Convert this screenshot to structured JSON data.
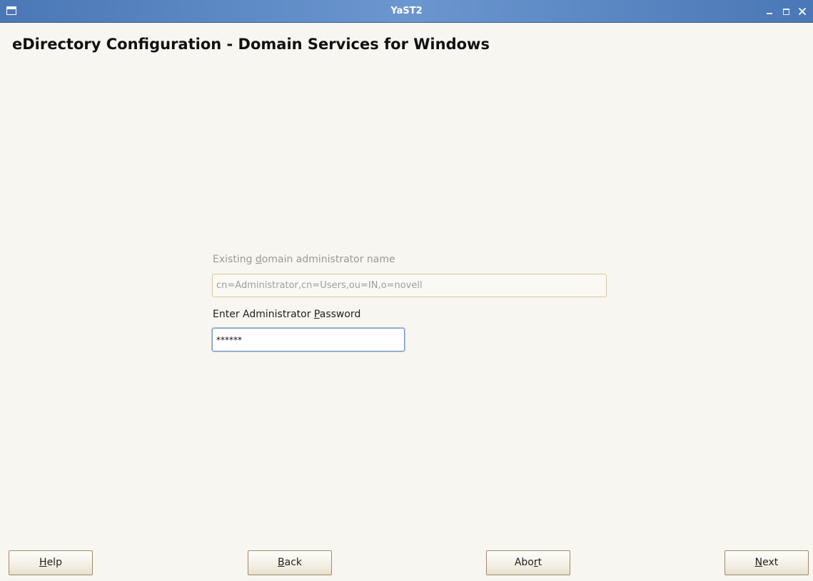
{
  "window": {
    "title": "YaST2"
  },
  "page": {
    "title": "eDirectory Configuration - Domain Services for Windows"
  },
  "form": {
    "admin_name": {
      "label_before": "Existing ",
      "label_mnemonic": "d",
      "label_after": "omain administrator name",
      "value": "cn=Administrator,cn=Users,ou=IN,o=novell",
      "disabled": true
    },
    "password": {
      "label_before": "Enter Administrator ",
      "label_mnemonic": "P",
      "label_after": "assword",
      "value": "******"
    }
  },
  "buttons": {
    "help": {
      "before": "",
      "mnemonic": "H",
      "after": "elp"
    },
    "back": {
      "before": "",
      "mnemonic": "B",
      "after": "ack"
    },
    "abort": {
      "before": "Abo",
      "mnemonic": "r",
      "after": "t"
    },
    "next": {
      "before": "",
      "mnemonic": "N",
      "after": "ext"
    }
  },
  "colors": {
    "titlebar": "#5a85c2",
    "background": "#f8f6f0",
    "button_border": "#a08b68",
    "focus_ring": "#a8c2e3"
  },
  "icons": {
    "window_menu": "window-menu-icon",
    "minimize": "minimize-icon",
    "maximize": "maximize-icon",
    "close": "close-icon"
  }
}
